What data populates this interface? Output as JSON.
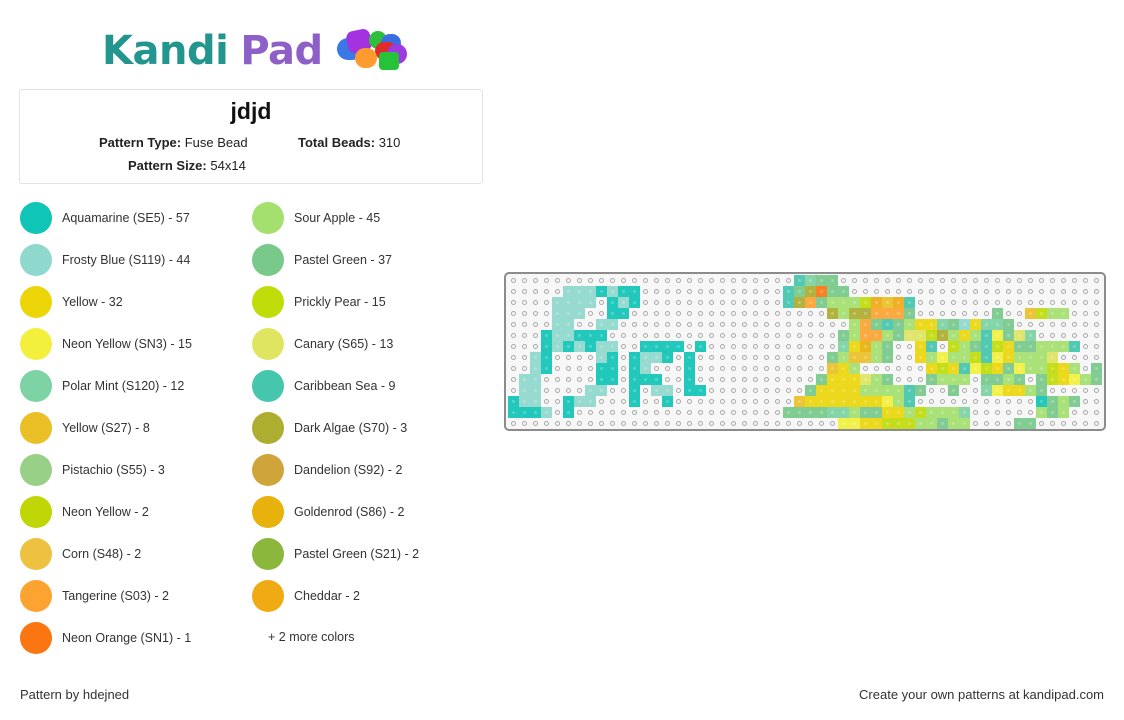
{
  "brand": {
    "name_part1": "Kandi",
    "name_part2": "Pad",
    "logo_icon": "beads-icon"
  },
  "pattern": {
    "title": "jdjd",
    "type_label": "Pattern Type:",
    "type_value": "Fuse Bead",
    "total_label": "Total Beads:",
    "total_value": "310",
    "size_label": "Pattern Size:",
    "size_value": "54x14"
  },
  "legend": {
    "column1": [
      {
        "label": "Aquamarine (SE5) - 57",
        "color": "#0fc5b6"
      },
      {
        "label": "Frosty Blue (S119) - 44",
        "color": "#8ed8cd"
      },
      {
        "label": "Yellow - 32",
        "color": "#ecd60a"
      },
      {
        "label": "Neon Yellow (SN3) - 15",
        "color": "#f2f03c"
      },
      {
        "label": "Polar Mint (S120) - 12",
        "color": "#7dd3a3"
      },
      {
        "label": "Yellow (S27) - 8",
        "color": "#ebc027"
      },
      {
        "label": "Pistachio (S55) - 3",
        "color": "#98d088"
      },
      {
        "label": "Neon Yellow - 2",
        "color": "#c0d606"
      },
      {
        "label": "Corn (S48) - 2",
        "color": "#ecc240"
      },
      {
        "label": "Tangerine (S03) - 2",
        "color": "#fca332"
      },
      {
        "label": "Neon Orange (SN1) - 1",
        "color": "#fb7611"
      }
    ],
    "column2": [
      {
        "label": "Sour Apple - 45",
        "color": "#a4e06e"
      },
      {
        "label": "Pastel Green - 37",
        "color": "#78c98a"
      },
      {
        "label": "Prickly Pear - 15",
        "color": "#c0dc0a"
      },
      {
        "label": "Canary (S65) - 13",
        "color": "#dfe561"
      },
      {
        "label": "Caribbean Sea - 9",
        "color": "#45c6ad"
      },
      {
        "label": "Dark Algae (S70) - 3",
        "color": "#adae30"
      },
      {
        "label": "Dandelion (S92) - 2",
        "color": "#cfa53b"
      },
      {
        "label": "Goldenrod (S86) - 2",
        "color": "#e8b10c"
      },
      {
        "label": "Pastel Green (S21) - 2",
        "color": "#8bb73c"
      },
      {
        "label": "Cheddar - 2",
        "color": "#f0ab14"
      }
    ],
    "more_colors": "+ 2 more colors"
  },
  "grid": {
    "columns": 54,
    "rows": 14,
    "palette": {
      "A": "#0fc5b6",
      "F": "#8ed8cd",
      "Y": "#ecd60a",
      "N": "#f2f03c",
      "P": "#7dd3a3",
      "G": "#ebc027",
      "S": "#a4e06e",
      "L": "#78c98a",
      "R": "#c0dc0a",
      "C": "#dfe561",
      "B": "#45c6ad",
      "D": "#adae30",
      "T": "#fca332",
      "O": "#fb7611",
      "K": "#e8b10c",
      "H": "#f0ab14"
    },
    "rows_data": [
      "..........................BPLL........................",
      ".....FFFAFAA.............BLDOLL.......................",
      "....FFFF.AFA.............BDTLSSSRHGHB.................",
      "....FFF..AA..................DSDDTTTL.......L..GRSS....",
      "....FF..FF.....................STLBLSYYPLFYPPL........",
      "...AFFAAA.....................LSTTSLCCRDSYSBNLCP......",
      "...AFAFAFF..AAAA.A............PYKSL..YB.RSLBRYLLSSSB..",
      "..FA....FA.AFFA.A............LSGGSL..YSNSSRBNYSSSC....",
      "..FA....AA.AF...A............GYS......YRYBNRYLNSSRYS.LF",
      ".FF.....AA.AAA..A...........LYYYCSL...LSSS.LLSL.LRYNSL",
      ".FF....FF..A.FF.AA.........LYYYYSSSSBL..L..PNYYSL....",
      "AFF..AFF...A..A...........GYYYYYYYNSB...........ALSL..",
      "AAAF A...................LLLLPPSLLYYSRSSSP......SLS....",
      "..............................NNYYRRRSSLSS....LL......"
    ]
  },
  "footer": {
    "author": "Pattern by hdejned",
    "cta": "Create your own patterns at kandipad.com"
  }
}
